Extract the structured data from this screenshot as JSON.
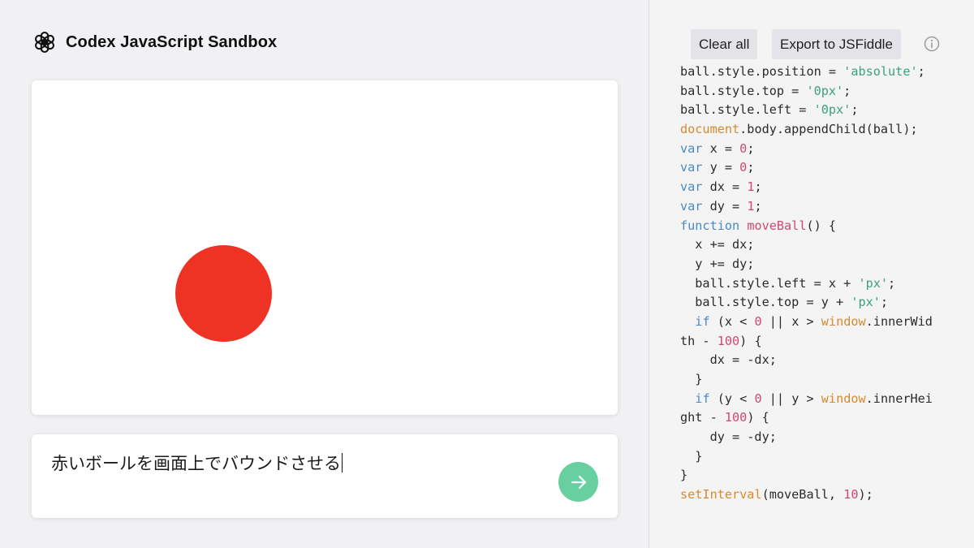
{
  "app": {
    "title": "Codex JavaScript Sandbox",
    "logo_icon": "openai-logo-icon"
  },
  "toolbar": {
    "clear_label": "Clear all",
    "export_label": "Export to JSFiddle",
    "info_icon": "info-icon"
  },
  "preview": {
    "ball_color": "#ee3324"
  },
  "prompt": {
    "text": "赤いボールを画面上でバウンドさせる",
    "send_icon": "arrow-right-icon",
    "send_color": "#68cfa0"
  },
  "colors": {
    "string": "#3aa27b",
    "keyword": "#4a8ac4",
    "number": "#d1496c",
    "builtin": "#d78a2a"
  },
  "code_lines": [
    [
      [
        "plain",
        "ball.style.position = "
      ],
      [
        "string",
        "'absolute'"
      ],
      [
        "plain",
        ";"
      ]
    ],
    [
      [
        "plain",
        "ball.style.top = "
      ],
      [
        "string",
        "'0px'"
      ],
      [
        "plain",
        ";"
      ]
    ],
    [
      [
        "plain",
        "ball.style.left = "
      ],
      [
        "string",
        "'0px'"
      ],
      [
        "plain",
        ";"
      ]
    ],
    [
      [
        "builtin",
        "document"
      ],
      [
        "plain",
        ".body.appendChild(ball);"
      ]
    ],
    [
      [
        "keyword",
        "var"
      ],
      [
        "plain",
        " x = "
      ],
      [
        "number",
        "0"
      ],
      [
        "plain",
        ";"
      ]
    ],
    [
      [
        "keyword",
        "var"
      ],
      [
        "plain",
        " y = "
      ],
      [
        "number",
        "0"
      ],
      [
        "plain",
        ";"
      ]
    ],
    [
      [
        "keyword",
        "var"
      ],
      [
        "plain",
        " dx = "
      ],
      [
        "number",
        "1"
      ],
      [
        "plain",
        ";"
      ]
    ],
    [
      [
        "keyword",
        "var"
      ],
      [
        "plain",
        " dy = "
      ],
      [
        "number",
        "1"
      ],
      [
        "plain",
        ";"
      ]
    ],
    [
      [
        "keyword",
        "function"
      ],
      [
        "plain",
        " "
      ],
      [
        "fn",
        "moveBall"
      ],
      [
        "plain",
        "() {"
      ]
    ],
    [
      [
        "plain",
        "  x += dx;"
      ]
    ],
    [
      [
        "plain",
        "  y += dy;"
      ]
    ],
    [
      [
        "plain",
        "  ball.style.left = x + "
      ],
      [
        "string",
        "'px'"
      ],
      [
        "plain",
        ";"
      ]
    ],
    [
      [
        "plain",
        "  ball.style.top = y + "
      ],
      [
        "string",
        "'px'"
      ],
      [
        "plain",
        ";"
      ]
    ],
    [
      [
        "plain",
        "  "
      ],
      [
        "keyword",
        "if"
      ],
      [
        "plain",
        " (x < "
      ],
      [
        "number",
        "0"
      ],
      [
        "plain",
        " || x > "
      ],
      [
        "builtin",
        "window"
      ],
      [
        "plain",
        ".innerWid"
      ]
    ],
    [
      [
        "plain",
        "th - "
      ],
      [
        "number",
        "100"
      ],
      [
        "plain",
        ") {"
      ]
    ],
    [
      [
        "plain",
        "    dx = -dx;"
      ]
    ],
    [
      [
        "plain",
        "  }"
      ]
    ],
    [
      [
        "plain",
        "  "
      ],
      [
        "keyword",
        "if"
      ],
      [
        "plain",
        " (y < "
      ],
      [
        "number",
        "0"
      ],
      [
        "plain",
        " || y > "
      ],
      [
        "builtin",
        "window"
      ],
      [
        "plain",
        ".innerHei"
      ]
    ],
    [
      [
        "plain",
        "ght - "
      ],
      [
        "number",
        "100"
      ],
      [
        "plain",
        ") {"
      ]
    ],
    [
      [
        "plain",
        "    dy = -dy;"
      ]
    ],
    [
      [
        "plain",
        "  }"
      ]
    ],
    [
      [
        "plain",
        "}"
      ]
    ],
    [
      [
        "builtin",
        "setInterval"
      ],
      [
        "plain",
        "(moveBall, "
      ],
      [
        "number",
        "10"
      ],
      [
        "plain",
        ");"
      ]
    ]
  ]
}
